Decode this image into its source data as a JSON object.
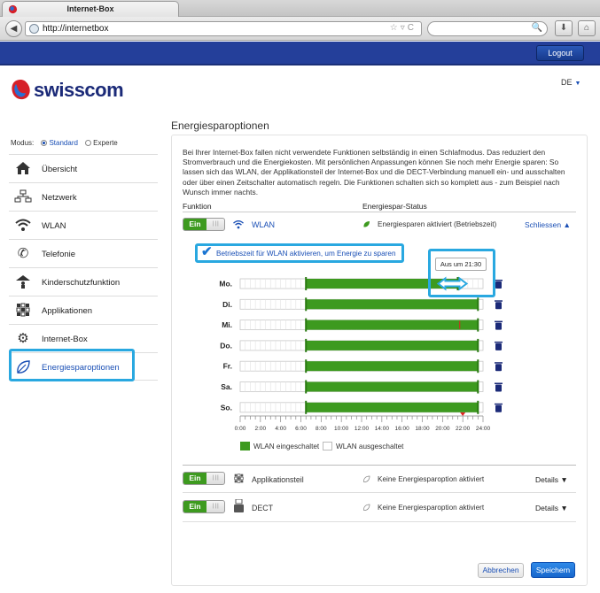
{
  "browser": {
    "tab_title": "Internet-Box",
    "url": "http://internetbox"
  },
  "header": {
    "logout_label": "Logout",
    "brand_name": "swisscom",
    "language": "DE"
  },
  "sidebar": {
    "modus_label": "Modus:",
    "mode_standard": "Standard",
    "mode_expert": "Experte",
    "items": [
      {
        "label": "Übersicht",
        "icon": "home-icon"
      },
      {
        "label": "Netzwerk",
        "icon": "network-icon"
      },
      {
        "label": "WLAN",
        "icon": "wifi-icon"
      },
      {
        "label": "Telefonie",
        "icon": "phone-icon"
      },
      {
        "label": "Kinderschutzfunktion",
        "icon": "child-protection-icon"
      },
      {
        "label": "Applikationen",
        "icon": "apps-icon"
      },
      {
        "label": "Internet-Box",
        "icon": "gear-icon"
      },
      {
        "label": "Energiesparoptionen",
        "icon": "leaf-icon"
      }
    ]
  },
  "main": {
    "title": "Energiesparoptionen",
    "intro": "Bei Ihrer Internet-Box fallen nicht verwendete Funktionen selbständig in einen Schlafmodus. Das reduziert den Stromverbrauch und die Energiekosten. Mit persönlichen Anpassungen können Sie noch mehr Energie sparen: So lassen sich das WLAN, der Applikationsteil der Internet-Box und die DECT-Verbindung manuell ein- und ausschalten oder über einen Zeitschalter automatisch regeln. Die Funktionen schalten sich so komplett aus - zum Beispiel nach Wunsch immer nachts.",
    "col_function": "Funktion",
    "col_status": "Energiespar-Status",
    "toggle_on": "Ein",
    "rows": [
      {
        "name": "WLAN",
        "status": "Energiesparen aktiviert (Betriebszeit)",
        "action": "Schliessen"
      },
      {
        "name": "Applikationsteil",
        "status": "Keine Energiesparoption aktiviert",
        "action": "Details"
      },
      {
        "name": "DECT",
        "status": "Keine Energiesparoption aktiviert",
        "action": "Details"
      }
    ],
    "schedule_checkbox": "Betriebszeit für WLAN aktivieren, um Energie zu sparen",
    "tooltip": "Aus um  21:30",
    "legend_on": "WLAN eingeschaltet",
    "legend_off": "WLAN ausgeschaltet",
    "cancel_label": "Abbrechen",
    "save_label": "Speichern"
  },
  "colors": {
    "brand_blue": "#243f9a",
    "link_blue": "#1a4fb5",
    "on_green": "#3d9a1f",
    "highlight": "#29a8e0"
  },
  "chart_data": {
    "type": "schedule",
    "x_ticks": [
      "0:00",
      "2:00",
      "4:00",
      "6:00",
      "8:00",
      "10:00",
      "12:00",
      "14:00",
      "16:00",
      "18:00",
      "20:00",
      "22:00",
      "24:00"
    ],
    "xlim": [
      0,
      24
    ],
    "days": [
      {
        "day": "Mo.",
        "on_from": 6.5,
        "on_to": 21.5
      },
      {
        "day": "Di.",
        "on_from": 6.5,
        "on_to": 23.5
      },
      {
        "day": "Mi.",
        "on_from": 6.5,
        "on_to": 23.5
      },
      {
        "day": "Do.",
        "on_from": 6.5,
        "on_to": 23.5
      },
      {
        "day": "Fr.",
        "on_from": 6.5,
        "on_to": 23.5
      },
      {
        "day": "Sa.",
        "on_from": 6.5,
        "on_to": 23.5
      },
      {
        "day": "So.",
        "on_from": 6.5,
        "on_to": 23.5
      }
    ]
  }
}
